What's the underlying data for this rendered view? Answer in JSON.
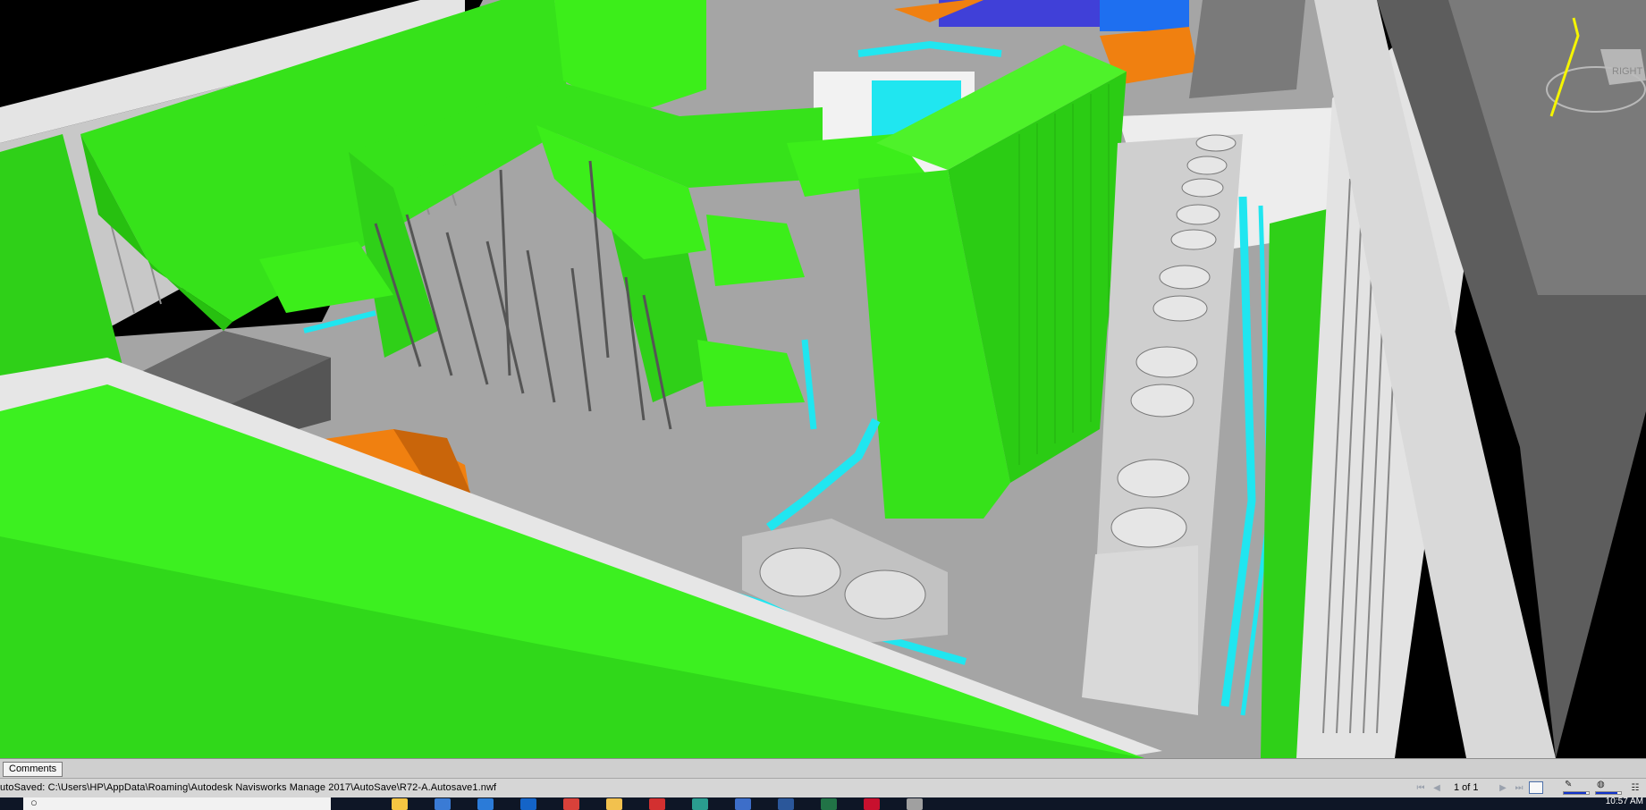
{
  "viewport": {
    "cube_label": "RIGHT"
  },
  "comments_tab": {
    "label": "Comments"
  },
  "status": {
    "text": "utoSaved: C:\\Users\\HP\\AppData\\Roaming\\Autodesk Navisworks Manage 2017\\AutoSave\\R72-A.Autosave1.nwf",
    "page_indicator": "1 of 1",
    "pencil_meter_fill": 0.9,
    "disk_meter_fill": 0.85
  },
  "taskbar": {
    "time": "10:57 AM",
    "icons": [
      "search-icon",
      "file-explorer-icon",
      "store-icon",
      "edge-icon",
      "outlook-icon",
      "chrome-icon",
      "folder-icon",
      "acrobat-icon",
      "navisworks-icon",
      "revit-icon",
      "word-icon",
      "excel-icon",
      "autocad-icon",
      "media-icon"
    ]
  },
  "colors": {
    "duct_green": "#3cee1a",
    "pipe_cyan": "#20e6f0",
    "equipment_orange": "#f08010",
    "floor_gray": "#a4a4a4",
    "parapet_gray": "#d6d6d6"
  }
}
